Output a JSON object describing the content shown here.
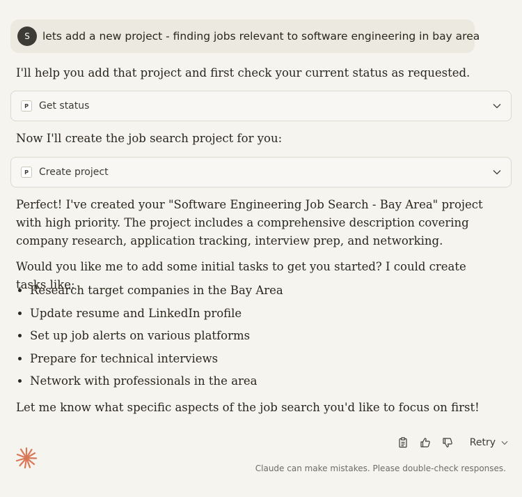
{
  "user_message": {
    "avatar_initial": "S",
    "text": "lets add a new project - finding jobs relevant to software engineering in bay area"
  },
  "assistant": {
    "intro": "I'll help you add that project and first check your current status as requested.",
    "tool_calls": [
      {
        "badge": "P",
        "label": "Get status"
      },
      {
        "badge": "P",
        "label": "Create project"
      }
    ],
    "between_text": "Now I'll create the job search project for you:",
    "summary": "Perfect! I've created your \"Software Engineering Job Search - Bay Area\" project with high priority. The project includes a comprehensive description covering company research, application tracking, interview prep, and networking.",
    "question": "Would you like me to add some initial tasks to get you started? I could create tasks like:",
    "tasks": [
      "Research target companies in the Bay Area",
      "Update resume and LinkedIn profile",
      "Set up job alerts on various platforms",
      "Prepare for technical interviews",
      "Network with professionals in the area"
    ],
    "closing": "Let me know what specific aspects of the job search you'd like to focus on first!"
  },
  "actions": {
    "copy_icon": "clipboard-icon",
    "thumbs_up_icon": "thumbs-up-icon",
    "thumbs_down_icon": "thumbs-down-icon",
    "retry_label": "Retry"
  },
  "footer": {
    "disclaimer": "Claude can make mistakes. Please double-check responses."
  },
  "colors": {
    "background": "#f5f4ef",
    "user_bubble": "#ebe9e0",
    "accent_logo": "#d97757"
  }
}
